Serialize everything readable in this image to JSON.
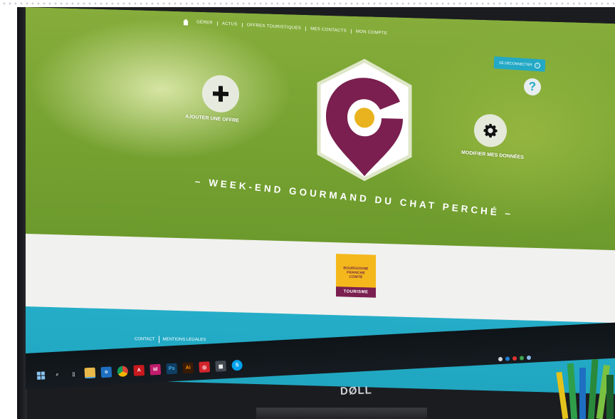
{
  "nav": {
    "items": [
      "GÉRER",
      "ACTUS",
      "OFFRES TOURISTIQUES",
      "MES CONTACTS",
      "MON COMPTE"
    ]
  },
  "logout_button": {
    "label": "SE DÉCONNECTER"
  },
  "help_icon": {
    "glyph": "?"
  },
  "actions": {
    "add_offer": {
      "label": "AJOUTER UNE OFFRE"
    },
    "edit_data": {
      "label": "MODIFIER MES DONNÉES"
    }
  },
  "subtitle": "– WEEK-END GOURMAND DU CHAT PERCHÉ –",
  "partner_logo": {
    "lines": [
      "BOURGOGNE",
      "FRANCHE",
      "COMTÉ"
    ],
    "tag": "TOURISME"
  },
  "footer": {
    "links": [
      "CONTACT",
      "MENTIONS LÉGALES"
    ]
  },
  "monitor_brand": "DØLL",
  "colors": {
    "hero_green": "#7aa533",
    "teal": "#1fa5c0",
    "logo_maroon": "#7a1f4f",
    "logo_yellow": "#e9b31f",
    "partner_yellow": "#f5b81c"
  },
  "taskbar_icons": [
    "windows-start-icon",
    "search-icon",
    "task-view-icon",
    "file-explorer-icon",
    "outlook-icon",
    "chrome-icon",
    "acrobat-icon",
    "indesign-icon",
    "photoshop-icon",
    "illustrator-icon",
    "pdf-tool-icon",
    "calculator-icon",
    "skype-icon"
  ]
}
